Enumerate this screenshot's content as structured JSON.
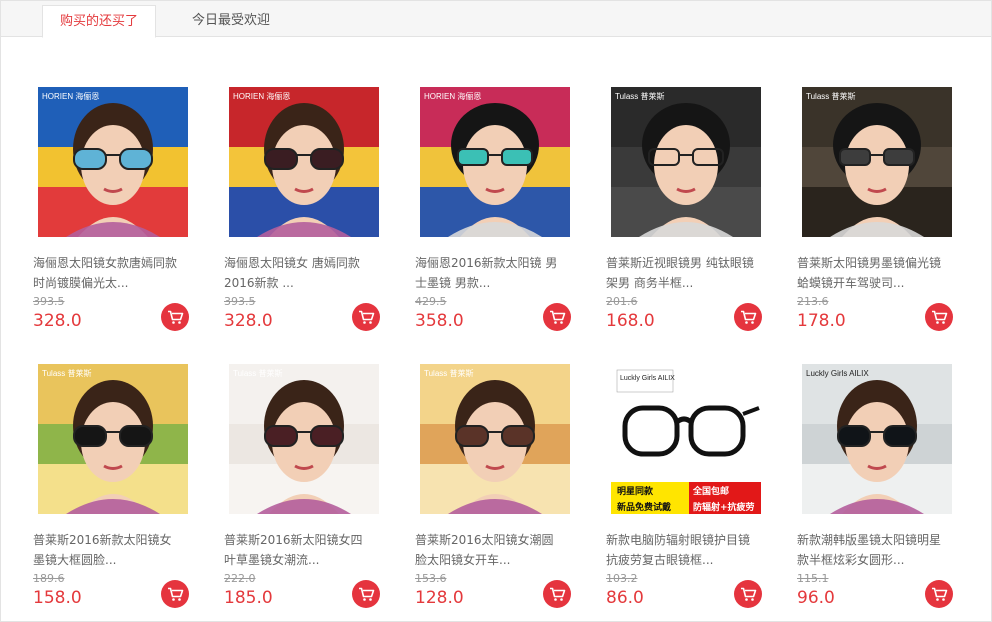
{
  "tabs": [
    {
      "label": "购买的还买了",
      "active": true
    },
    {
      "label": "今日最受欢迎",
      "active": false
    }
  ],
  "accent_color": "#e4393c",
  "products": [
    {
      "title": "海俪恩太阳镜女款唐嫣同款 时尚镀膜偏光太...",
      "original_price": "393.5",
      "price": "328.0",
      "brand_mark": "HORIEN 海俪恩",
      "image": "woman-mirrored-sunglasses"
    },
    {
      "title": "海俪恩太阳镜女 唐嫣同款2016新款 ...",
      "original_price": "393.5",
      "price": "328.0",
      "brand_mark": "HORIEN 海俪恩",
      "image": "woman-dark-sunglasses"
    },
    {
      "title": "海俪恩2016新款太阳镜 男士墨镜 男款...",
      "original_price": "429.5",
      "price": "358.0",
      "brand_mark": "HORIEN 海俪恩",
      "image": "man-mirrored-aviators"
    },
    {
      "title": "普莱斯近视眼镜男 纯钛眼镜架男 商务半框...",
      "original_price": "201.6",
      "price": "168.0",
      "brand_mark": "Tulass 普莱斯",
      "image": "man-half-frame-glasses"
    },
    {
      "title": "普莱斯太阳镜男墨镜偏光镜蛤蟆镜开车驾驶司...",
      "original_price": "213.6",
      "price": "178.0",
      "brand_mark": "Tulass 普莱斯",
      "image": "man-aviator-sunglasses"
    },
    {
      "title": "普莱斯2016新款太阳镜女 墨镜大框圆脸...",
      "original_price": "189.6",
      "price": "158.0",
      "brand_mark": "Tulass 普莱斯",
      "image": "woman-black-sunglasses"
    },
    {
      "title": "普莱斯2016新太阳镜女四叶草墨镜女潮流...",
      "original_price": "222.0",
      "price": "185.0",
      "brand_mark": "Tulass 普莱斯",
      "image": "woman-red-sunglasses"
    },
    {
      "title": "普莱斯2016太阳镜女潮圆脸太阳镜女开车...",
      "original_price": "153.6",
      "price": "128.0",
      "brand_mark": "Tulass 普莱斯",
      "image": "woman-brown-sunglasses"
    },
    {
      "title": "新款电脑防辐射眼镜护目镜抗疲劳复古眼镜框...",
      "original_price": "103.2",
      "price": "86.0",
      "brand_mark": "Luckly Girls AILIX",
      "banner_lines": [
        "明星同款",
        "全国包邮",
        "新品免费试戴",
        "防辐射+抗疲劳"
      ],
      "image": "black-frame-glasses"
    },
    {
      "title": "新款潮韩版墨镜太阳镜明星款半框炫彩女圆形...",
      "original_price": "115.1",
      "price": "96.0",
      "brand_mark": "Luckly Girls AILIX",
      "image": "woman-round-sunglasses"
    }
  ]
}
